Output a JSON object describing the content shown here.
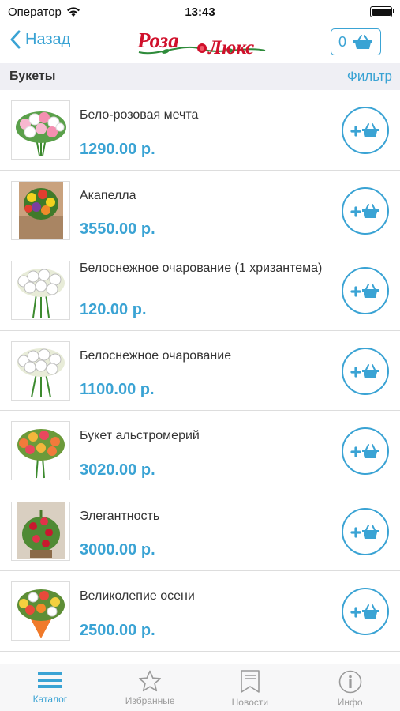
{
  "status_bar": {
    "carrier": "Оператор",
    "time": "13:43",
    "battery_level": 1.0
  },
  "nav": {
    "back_label": "Назад",
    "logo_text": "РозаЛюкс",
    "cart_count": "0"
  },
  "section": {
    "title": "Букеты",
    "filter_label": "Фильтр"
  },
  "products": [
    {
      "name": "Бело-розовая мечта",
      "price": "1290.00 р."
    },
    {
      "name": "Акапелла",
      "price": "3550.00 р."
    },
    {
      "name": "Белоснежное очарование (1 хризантема)",
      "price": "120.00 р."
    },
    {
      "name": "Белоснежное очарование",
      "price": "1100.00 р."
    },
    {
      "name": "Букет альстромерий",
      "price": "3020.00 р."
    },
    {
      "name": "Элегантность",
      "price": "3000.00 р."
    },
    {
      "name": "Великолепие осени",
      "price": "2500.00 р."
    }
  ],
  "tabs": [
    {
      "label": "Каталог",
      "icon": "list-icon",
      "active": true
    },
    {
      "label": "Избранные",
      "icon": "star-icon",
      "active": false
    },
    {
      "label": "Новости",
      "icon": "bookmark-icon",
      "active": false
    },
    {
      "label": "Инфо",
      "icon": "info-icon",
      "active": false
    }
  ],
  "colors": {
    "accent": "#3aa3d4",
    "logo_red": "#d0102b",
    "section_bg": "#efeff4",
    "tab_inactive": "#9a9a9a"
  }
}
